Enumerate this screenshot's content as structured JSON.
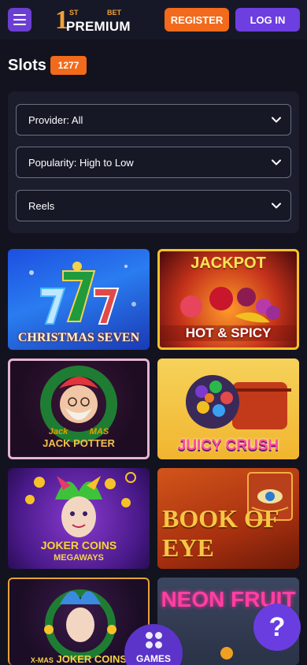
{
  "header": {
    "logo_top_left": "1",
    "logo_st": "ST",
    "logo_bet": "BET",
    "logo_premium": "PREMIUM",
    "register_label": "REGISTER",
    "login_label": "LOG IN",
    "menu_icon": "hamburger-icon"
  },
  "section": {
    "title": "Slots",
    "count": "1277"
  },
  "filters": [
    {
      "label": "Provider: All"
    },
    {
      "label": "Popularity: High to Low"
    },
    {
      "label": "Reels"
    }
  ],
  "games": [
    {
      "title": "CHRISTMAS SEVEN"
    },
    {
      "title_top": "JACKPOT",
      "title": "HOT & SPICY"
    },
    {
      "title": "JACK POTTER",
      "subtitle": "MAS"
    },
    {
      "title": "JUICY CRUSH"
    },
    {
      "title": "JOKER COINS",
      "subtitle": "MEGAWAYS"
    },
    {
      "title": "BOOK OF EYE"
    },
    {
      "title": "JOKER COINS",
      "subtitle": "X-MAS"
    },
    {
      "title": "NEON FRUIT"
    }
  ],
  "floating": {
    "games_label": "GAMES",
    "help_label": "?"
  },
  "colors": {
    "accent_orange": "#f26a1b",
    "accent_purple": "#6d3ee0",
    "background": "#12131f"
  }
}
